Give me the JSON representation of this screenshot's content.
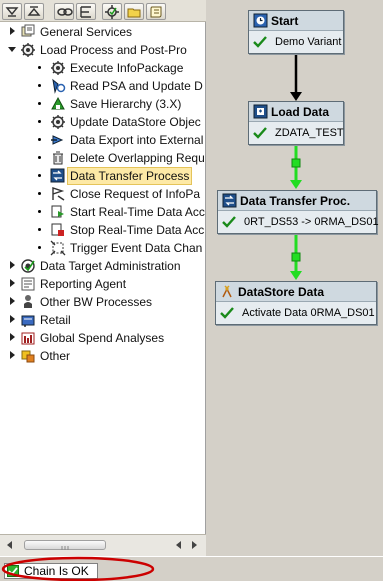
{
  "toolbar": {
    "buttons": [
      "expand-all",
      "collapse-all",
      "link",
      "filter",
      "settings",
      "folder",
      "script"
    ]
  },
  "tree": {
    "items": [
      {
        "label": "General Services",
        "level": 0,
        "expanded": false,
        "icon": "services-icon"
      },
      {
        "label": "Load Process and Post-Pro",
        "level": 0,
        "expanded": true,
        "icon": "gear-icon"
      },
      {
        "label": "Execute InfoPackage",
        "level": 1,
        "icon": "gear-icon"
      },
      {
        "label": "Read PSA and Update D",
        "level": 1,
        "icon": "read-psa-icon"
      },
      {
        "label": "Save Hierarchy (3.X)",
        "level": 1,
        "icon": "hierarchy-icon"
      },
      {
        "label": "Update DataStore Objec",
        "level": 1,
        "icon": "gear-icon"
      },
      {
        "label": "Data Export into External",
        "level": 1,
        "icon": "export-icon"
      },
      {
        "label": "Delete Overlapping Requ",
        "level": 1,
        "icon": "trash-icon"
      },
      {
        "label": "Data Transfer Process",
        "level": 1,
        "icon": "dtp-icon",
        "selected": true
      },
      {
        "label": "Close Request of InfoPa",
        "level": 1,
        "icon": "close-request-icon"
      },
      {
        "label": "Start Real-Time Data Acc",
        "level": 1,
        "icon": "start-realtime-icon"
      },
      {
        "label": "Stop Real-Time Data Acc",
        "level": 1,
        "icon": "stop-realtime-icon"
      },
      {
        "label": "Trigger Event Data Chan",
        "level": 1,
        "icon": "trigger-icon"
      },
      {
        "label": "Data Target Administration",
        "level": 0,
        "expanded": false,
        "icon": "target-icon"
      },
      {
        "label": "Reporting Agent",
        "level": 0,
        "expanded": false,
        "icon": "reporting-icon"
      },
      {
        "label": "Other BW Processes",
        "level": 0,
        "expanded": false,
        "icon": "processes-icon"
      },
      {
        "label": "Retail",
        "level": 0,
        "expanded": false,
        "icon": "retail-icon"
      },
      {
        "label": "Global Spend Analyses",
        "level": 0,
        "expanded": false,
        "icon": "spend-icon"
      },
      {
        "label": "Other",
        "level": 0,
        "expanded": false,
        "icon": "other-icon"
      }
    ]
  },
  "diagram": {
    "nodes": [
      {
        "key": "start",
        "title": "Start",
        "text": "Demo Variant",
        "icon": "start-icon"
      },
      {
        "key": "load",
        "title": "Load Data",
        "text": "ZDATA_TEST",
        "icon": "load-data-icon"
      },
      {
        "key": "dtp",
        "title": "Data Transfer Proc.",
        "text": "0RT_DS53 -> 0RMA_DS01",
        "icon": "dtp-icon"
      },
      {
        "key": "dso",
        "title": "DataStore Data",
        "text": "Activate Data 0RMA_DS01",
        "icon": "datastore-icon"
      }
    ],
    "colors": {
      "start_link": "#000000",
      "success_link": "#22dd22",
      "node_header": "#cfd9e0",
      "node_body": "#e6ecf0"
    }
  },
  "status": {
    "text": "Chain Is OK",
    "highlight_color": "#cc0000"
  }
}
